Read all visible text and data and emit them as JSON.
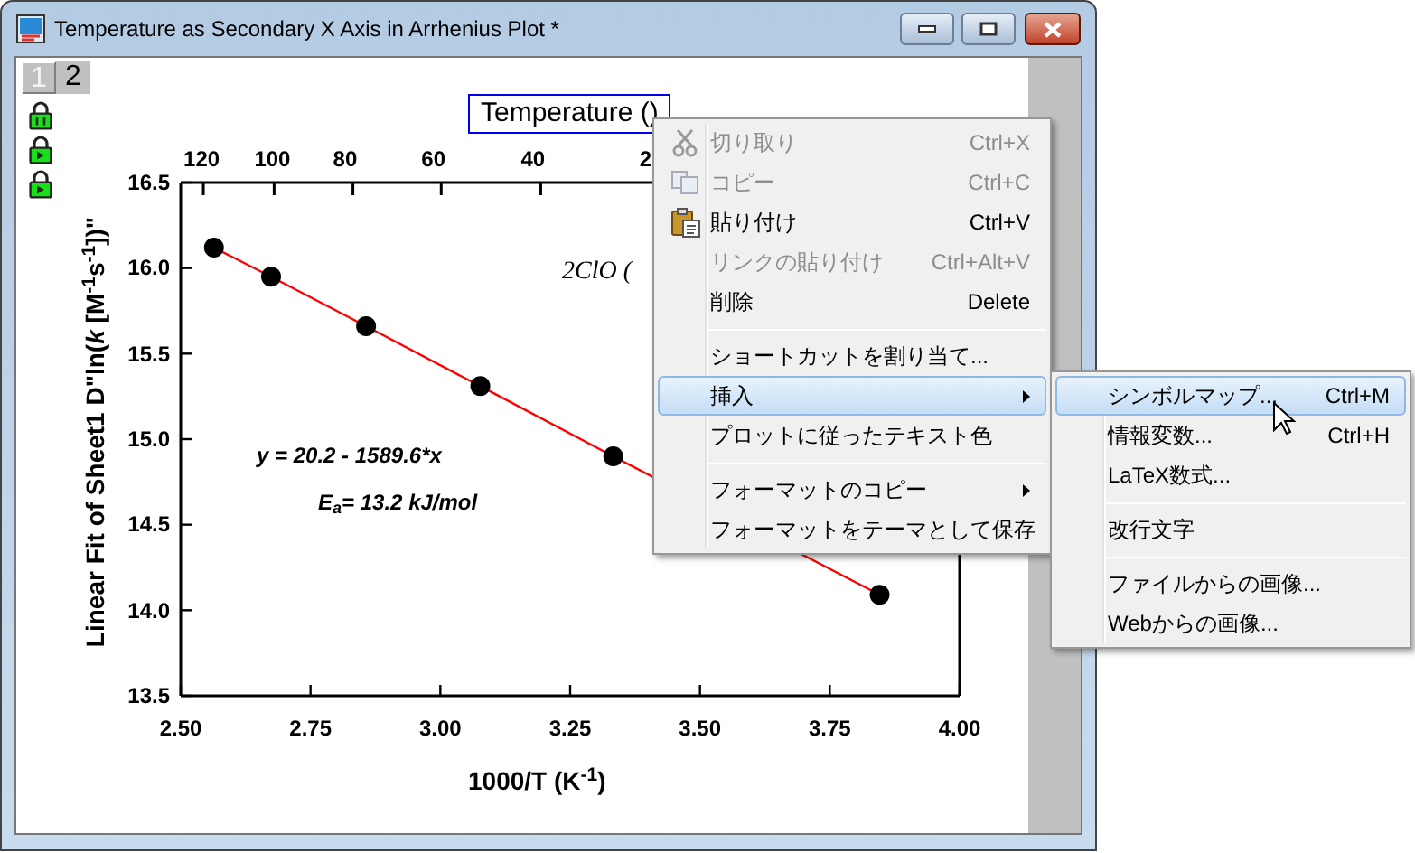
{
  "window": {
    "title": "Temperature as Secondary X Axis in Arrhenius Plot *"
  },
  "page_tabs": [
    {
      "label": "1",
      "selected": true
    },
    {
      "label": "2",
      "selected": false
    }
  ],
  "graph": {
    "title_box": "Temperature ()",
    "top_axis": {
      "ticks": [
        "120",
        "100",
        "80",
        "60",
        "40",
        "2"
      ]
    },
    "chart_data": {
      "type": "line",
      "xlabel": "1000/T (K$^{-1}$)",
      "ylabel": "Linear Fit of Sheet1 D\"ln(*k* [M$^{-1}$s$^{-1}$])\"",
      "xlim": [
        2.5,
        4.0
      ],
      "ylim": [
        13.5,
        16.5
      ],
      "x": [
        2.564,
        2.674,
        2.857,
        3.077,
        3.333,
        3.636,
        3.846
      ],
      "series": [
        {
          "color": "#ff0000",
          "marker": "circle",
          "values": [
            16.12,
            15.95,
            15.66,
            15.31,
            14.9,
            null,
            14.09
          ]
        }
      ],
      "xticks": [
        {
          "value": 2.5,
          "label": "2.50"
        },
        {
          "value": 2.75,
          "label": "2.75"
        },
        {
          "value": 3.0,
          "label": "3.00"
        },
        {
          "value": 3.25,
          "label": "3.25"
        },
        {
          "value": 3.5,
          "label": "3.50"
        },
        {
          "value": 3.75,
          "label": "3.75"
        },
        {
          "value": 4.0,
          "label": "4.00"
        }
      ],
      "yticks": [
        {
          "value": 13.5,
          "label": "13.5"
        },
        {
          "value": 14.0,
          "label": "14.0"
        },
        {
          "value": 14.5,
          "label": "14.5"
        },
        {
          "value": 15.0,
          "label": "15.0"
        },
        {
          "value": 15.5,
          "label": "15.5"
        },
        {
          "value": 16.0,
          "label": "16.0"
        },
        {
          "value": 16.5,
          "label": "16.5"
        }
      ],
      "annotations": [
        "y = 20.2 - 1589.6*x",
        "E$_{a}$= 13.2 kJ/mol",
        "2ClO ("
      ]
    }
  },
  "context_menu": {
    "items": [
      {
        "kind": "item",
        "label": "切り取り",
        "shortcut": "Ctrl+X",
        "disabled": true,
        "selected": false
      },
      {
        "kind": "item",
        "label": "コピー",
        "shortcut": "Ctrl+C",
        "disabled": true,
        "selected": false
      },
      {
        "kind": "item",
        "label": "貼り付け",
        "shortcut": "Ctrl+V",
        "disabled": false,
        "selected": false
      },
      {
        "kind": "item",
        "label": "リンクの貼り付け",
        "shortcut": "Ctrl+Alt+V",
        "disabled": true,
        "selected": false
      },
      {
        "kind": "item",
        "label": "削除",
        "shortcut": "Delete",
        "disabled": false,
        "selected": false
      },
      {
        "kind": "separator"
      },
      {
        "kind": "item",
        "label": "ショートカットを割り当て...",
        "disabled": false,
        "selected": false
      },
      {
        "kind": "submenu",
        "label": "挿入",
        "disabled": false,
        "selected": true
      },
      {
        "kind": "item",
        "label": "プロットに従ったテキスト色",
        "disabled": false,
        "selected": false
      },
      {
        "kind": "separator"
      },
      {
        "kind": "submenu",
        "label": "フォーマットのコピー",
        "disabled": false,
        "selected": false
      },
      {
        "kind": "item",
        "label": "フォーマットをテーマとして保存",
        "disabled": false,
        "selected": false
      }
    ]
  },
  "submenu": {
    "items": [
      {
        "kind": "item",
        "label": "シンボルマップ...",
        "shortcut": "Ctrl+M",
        "disabled": false,
        "selected": true
      },
      {
        "kind": "item",
        "label": "情報変数...",
        "shortcut": "Ctrl+H",
        "disabled": false,
        "selected": false
      },
      {
        "kind": "item",
        "label": "LaTeX数式...",
        "disabled": false,
        "selected": false
      },
      {
        "kind": "separator"
      },
      {
        "kind": "item",
        "label": "改行文字",
        "disabled": false,
        "selected": false
      },
      {
        "kind": "separator"
      },
      {
        "kind": "item",
        "label": "ファイルからの画像...",
        "disabled": false,
        "selected": false
      },
      {
        "kind": "item",
        "label": "Webからの画像...",
        "disabled": false,
        "selected": false
      }
    ]
  }
}
